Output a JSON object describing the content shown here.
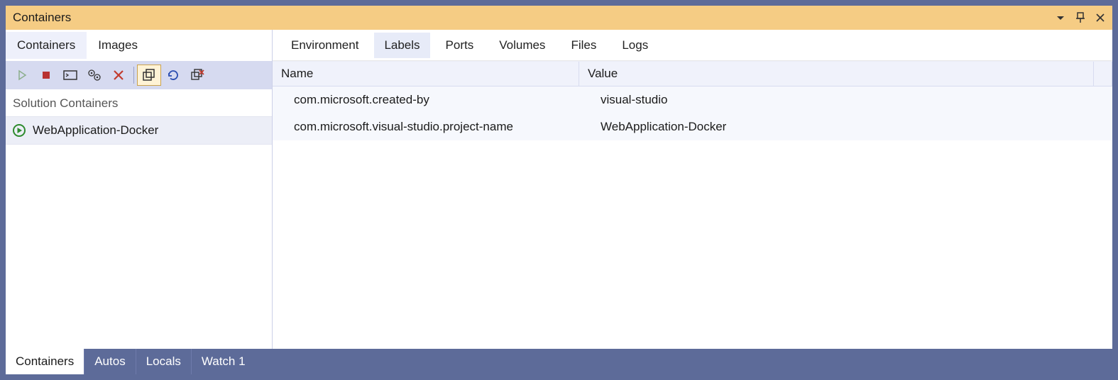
{
  "panel": {
    "title": "Containers"
  },
  "left": {
    "tabs": [
      {
        "label": "Containers",
        "selected": true
      },
      {
        "label": "Images",
        "selected": false
      }
    ],
    "toolbar_icons": [
      "play",
      "stop",
      "terminal",
      "gear",
      "delete",
      "divider",
      "copy-multi",
      "refresh",
      "prune"
    ],
    "section_label": "Solution Containers",
    "containers": [
      {
        "name": "WebApplication-Docker",
        "status": "running"
      }
    ]
  },
  "detail": {
    "tabs": [
      {
        "label": "Environment",
        "selected": false
      },
      {
        "label": "Labels",
        "selected": true
      },
      {
        "label": "Ports",
        "selected": false
      },
      {
        "label": "Volumes",
        "selected": false
      },
      {
        "label": "Files",
        "selected": false
      },
      {
        "label": "Logs",
        "selected": false
      }
    ],
    "table": {
      "columns": [
        "Name",
        "Value"
      ],
      "rows": [
        {
          "name": "com.microsoft.created-by",
          "value": "visual-studio"
        },
        {
          "name": "com.microsoft.visual-studio.project-name",
          "value": "WebApplication-Docker"
        }
      ]
    }
  },
  "bottom_tabs": [
    {
      "label": "Containers",
      "selected": true
    },
    {
      "label": "Autos",
      "selected": false
    },
    {
      "label": "Locals",
      "selected": false
    },
    {
      "label": "Watch 1",
      "selected": false
    }
  ]
}
